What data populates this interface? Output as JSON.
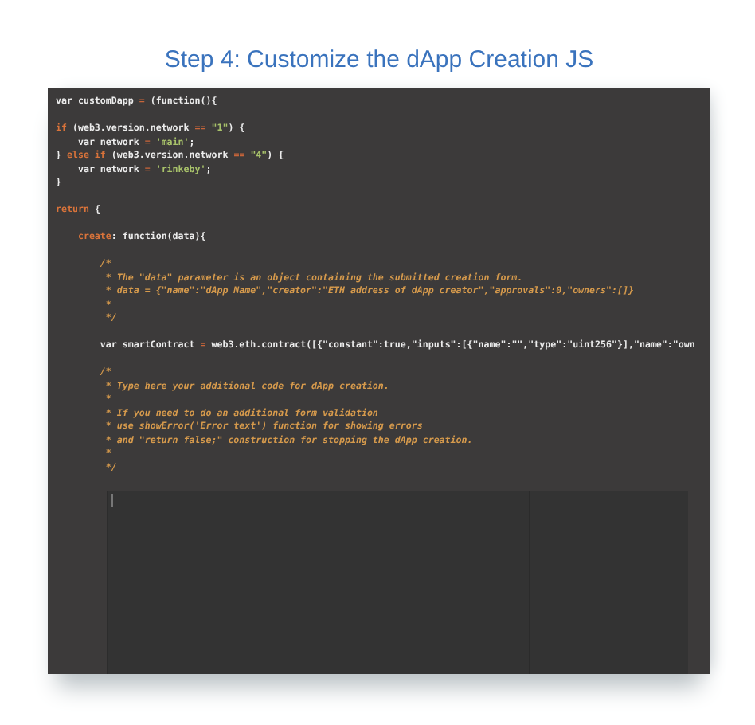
{
  "title": "Step 4: Customize the dApp Creation JS",
  "code": {
    "lines": [
      {
        "kind": "code",
        "tokens": [
          {
            "kind": "plain",
            "text": "var customDapp "
          },
          {
            "kind": "op",
            "text": "= "
          },
          {
            "kind": "plain",
            "text": "(function(){"
          }
        ]
      },
      {
        "kind": "blank"
      },
      {
        "kind": "code",
        "tokens": [
          {
            "kind": "keyword",
            "text": "if"
          },
          {
            "kind": "plain",
            "text": " (web3.version.network "
          },
          {
            "kind": "op",
            "text": "== "
          },
          {
            "kind": "string",
            "text": "\"1\""
          },
          {
            "kind": "plain",
            "text": ") {"
          }
        ]
      },
      {
        "kind": "code",
        "tokens": [
          {
            "kind": "plain",
            "text": "    var network "
          },
          {
            "kind": "op",
            "text": "= "
          },
          {
            "kind": "string",
            "text": "'main'"
          },
          {
            "kind": "plain",
            "text": ";"
          }
        ]
      },
      {
        "kind": "code",
        "tokens": [
          {
            "kind": "plain",
            "text": "} "
          },
          {
            "kind": "keyword",
            "text": "else if"
          },
          {
            "kind": "plain",
            "text": " (web3.version.network "
          },
          {
            "kind": "op",
            "text": "== "
          },
          {
            "kind": "string",
            "text": "\"4\""
          },
          {
            "kind": "plain",
            "text": ") {"
          }
        ]
      },
      {
        "kind": "code",
        "tokens": [
          {
            "kind": "plain",
            "text": "    var network "
          },
          {
            "kind": "op",
            "text": "= "
          },
          {
            "kind": "string",
            "text": "'rinkeby'"
          },
          {
            "kind": "plain",
            "text": ";"
          }
        ]
      },
      {
        "kind": "code",
        "tokens": [
          {
            "kind": "plain",
            "text": "}"
          }
        ]
      },
      {
        "kind": "blank"
      },
      {
        "kind": "code",
        "tokens": [
          {
            "kind": "keyword",
            "text": "return"
          },
          {
            "kind": "plain",
            "text": " {"
          }
        ]
      },
      {
        "kind": "blank"
      },
      {
        "kind": "code",
        "tokens": [
          {
            "kind": "keyword",
            "text": "    create"
          },
          {
            "kind": "plain",
            "text": ": function(data){"
          }
        ]
      },
      {
        "kind": "blank"
      },
      {
        "kind": "code",
        "tokens": [
          {
            "kind": "comment",
            "text": "        /*"
          }
        ]
      },
      {
        "kind": "code",
        "tokens": [
          {
            "kind": "comment",
            "text": "         * The \"data\" parameter is an object containing the submitted creation form."
          }
        ]
      },
      {
        "kind": "code",
        "tokens": [
          {
            "kind": "comment",
            "text": "         * data = {\"name\":\"dApp Name\",\"creator\":\"ETH address of dApp creator\",\"approvals\":0,\"owners\":[]}"
          }
        ]
      },
      {
        "kind": "code",
        "tokens": [
          {
            "kind": "comment",
            "text": "         *"
          }
        ]
      },
      {
        "kind": "code",
        "tokens": [
          {
            "kind": "comment",
            "text": "         */"
          }
        ]
      },
      {
        "kind": "blank"
      },
      {
        "kind": "code",
        "tokens": [
          {
            "kind": "plain",
            "text": "        var smartContract "
          },
          {
            "kind": "op",
            "text": "= "
          },
          {
            "kind": "plain",
            "text": "web3.eth.contract([{\"constant\":true,\"inputs\":[{\"name\":\"\",\"type\":\"uint256\"}],\"name\":\"own"
          }
        ]
      },
      {
        "kind": "blank"
      },
      {
        "kind": "code",
        "tokens": [
          {
            "kind": "comment",
            "text": "        /*"
          }
        ]
      },
      {
        "kind": "code",
        "tokens": [
          {
            "kind": "comment",
            "text": "         * Type here your additional code for dApp creation."
          }
        ]
      },
      {
        "kind": "code",
        "tokens": [
          {
            "kind": "comment",
            "text": "         *"
          }
        ]
      },
      {
        "kind": "code",
        "tokens": [
          {
            "kind": "comment",
            "text": "         * If you need to do an additional form validation"
          }
        ]
      },
      {
        "kind": "code",
        "tokens": [
          {
            "kind": "comment",
            "text": "         * use showError('Error text') function for showing errors"
          }
        ]
      },
      {
        "kind": "code",
        "tokens": [
          {
            "kind": "comment",
            "text": "         * and \"return false;\" construction for stopping the dApp creation."
          }
        ]
      },
      {
        "kind": "code",
        "tokens": [
          {
            "kind": "comment",
            "text": "         *"
          }
        ]
      },
      {
        "kind": "code",
        "tokens": [
          {
            "kind": "comment",
            "text": "         */"
          }
        ]
      }
    ]
  }
}
